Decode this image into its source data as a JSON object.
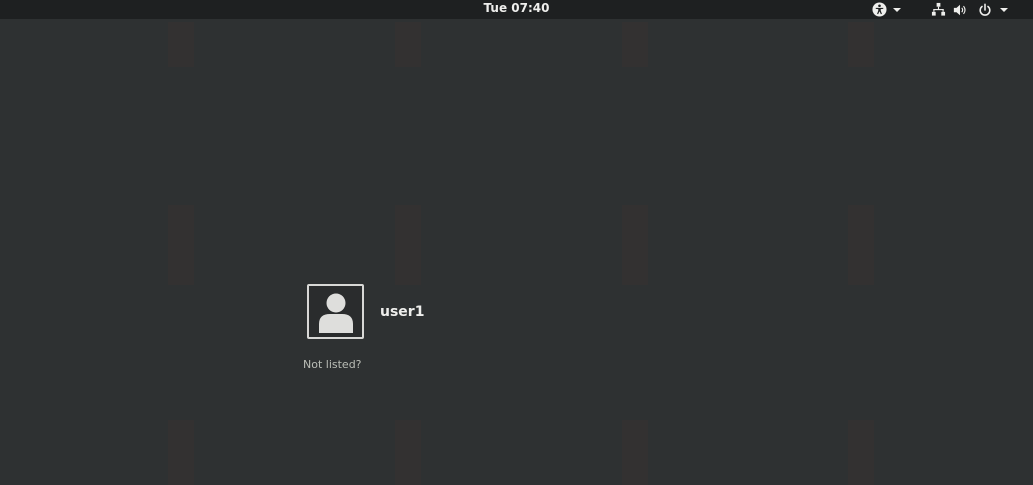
{
  "topbar": {
    "clock": "Tue 07:40",
    "icons": {
      "accessibility": "accessibility-icon",
      "network": "network-wired-icon",
      "volume": "volume-icon",
      "power": "power-icon"
    }
  },
  "login": {
    "users": [
      {
        "name": "user1",
        "avatar": "default-user-avatar-icon"
      }
    ],
    "not_listed_label": "Not listed?"
  },
  "colors": {
    "background": "#2e3132",
    "topbar": "#1e2021",
    "text": "#eeeeec",
    "muted_text": "#babdb6"
  }
}
